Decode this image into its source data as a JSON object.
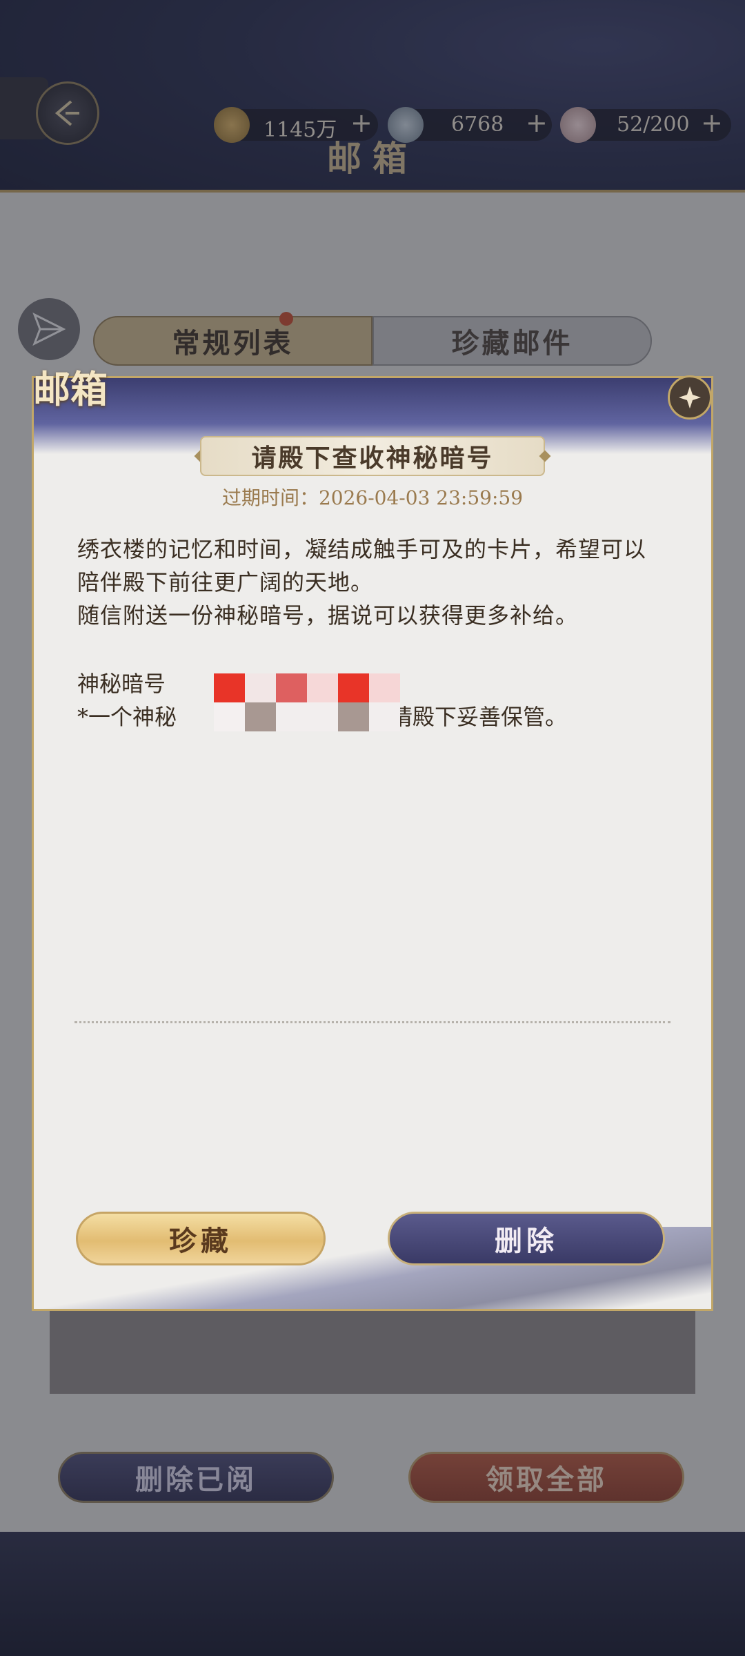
{
  "resources": [
    {
      "icon": "coin-icon",
      "value": "1145万",
      "color": "#8a6a2a"
    },
    {
      "icon": "jade-icon",
      "value": "6768",
      "color": "#8a9aa8"
    },
    {
      "icon": "bowl-icon",
      "value": "52/200",
      "color": "#c8a8a8"
    }
  ],
  "resource_plus": "+",
  "header_title": "邮箱",
  "tabs": [
    {
      "label": "常规列表",
      "active": true
    },
    {
      "label": "珍藏邮件",
      "active": false
    }
  ],
  "bottom_actions": {
    "delete_read": "删除已阅",
    "claim_all": "领取全部"
  },
  "modal": {
    "corner_title": "邮箱",
    "mail_title": "请殿下查收神秘暗号",
    "expire": "过期时间：2026-04-03 23:59:59",
    "body_lines": [
      "绣衣楼的记忆和时间，凝结成触手可及的卡片，希望可以",
      "陪伴殿下前往更广阔的天地。",
      "随信附送一份神秘暗号，据说可以获得更多补给。"
    ],
    "code_label": "神秘暗号",
    "code_note": "*一个神秘",
    "code_note_tail": "请殿下妥善保管。",
    "favorite_button": "珍藏",
    "delete_button": "删除"
  },
  "colors": {
    "accent_gold": "#c2a768",
    "mosaic_red": "#e83428"
  }
}
